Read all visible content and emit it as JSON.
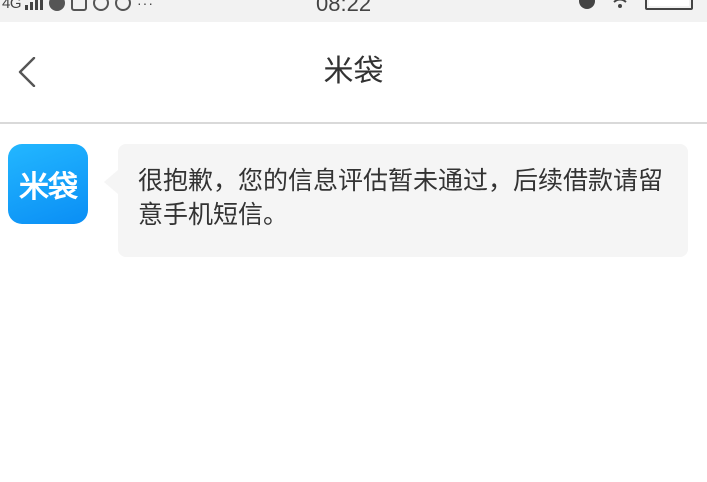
{
  "status_bar": {
    "network": "4G",
    "time": "08:22"
  },
  "header": {
    "title": "米袋",
    "back_icon": "chevron-left-icon"
  },
  "conversation": {
    "sender_avatar_text": "米袋",
    "sender_avatar_color": "#1aa3fb",
    "messages": [
      {
        "text": "很抱歉，您的信息评估暂未通过，后续借款请留意手机短信。"
      }
    ]
  },
  "colors": {
    "background": "#ffffff",
    "bubble": "#f5f5f5",
    "divider": "#d9d9d9",
    "text": "#333333"
  }
}
